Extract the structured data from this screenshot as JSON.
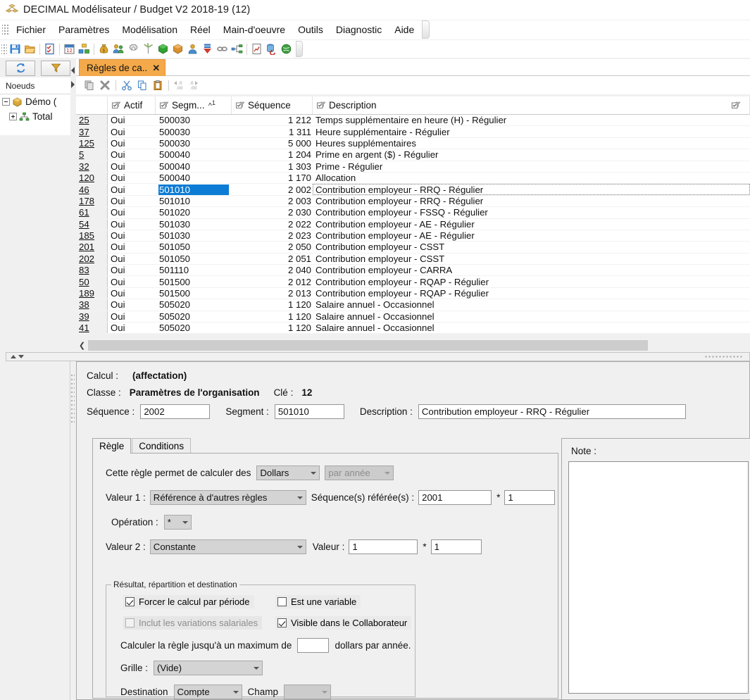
{
  "window": {
    "title": "DECIMAL Modélisateur / Budget V2 2018-19 (12)",
    "icon": "app-cubes-icon"
  },
  "menubar": {
    "items": [
      "Fichier",
      "Paramètres",
      "Modélisation",
      "Réel",
      "Main-d'oeuvre",
      "Outils",
      "Diagnostic",
      "Aide"
    ]
  },
  "toolbar": {
    "buttons": [
      {
        "name": "save-icon",
        "glyph": "save"
      },
      {
        "name": "open-folder-icon",
        "glyph": "folder"
      },
      {
        "name": "checklist-icon",
        "glyph": "checklist"
      },
      {
        "name": "calendar-icon",
        "glyph": "calendar"
      },
      {
        "name": "organization-icon",
        "glyph": "org"
      },
      {
        "name": "money-bag-icon",
        "glyph": "money"
      },
      {
        "name": "employees-icon",
        "glyph": "people"
      },
      {
        "name": "settings-gear-icon",
        "glyph": "gear"
      },
      {
        "name": "windmill-icon",
        "glyph": "windmill"
      },
      {
        "name": "green-cube-icon",
        "glyph": "greencube"
      },
      {
        "name": "orange-box-icon",
        "glyph": "orangebox"
      },
      {
        "name": "user-icon",
        "glyph": "user"
      },
      {
        "name": "import-down-arrows-icon",
        "glyph": "downarrows"
      },
      {
        "name": "link-chain-icon",
        "glyph": "chain"
      },
      {
        "name": "network-node-icon",
        "glyph": "network"
      },
      {
        "name": "report-chart-icon",
        "glyph": "report"
      },
      {
        "name": "database-refresh-icon",
        "glyph": "dbrefresh"
      },
      {
        "name": "refresh-globe-icon",
        "glyph": "globe"
      }
    ]
  },
  "secondary_toolbar": {
    "buttons": [
      {
        "name": "refresh-button",
        "icon": "refresh-icon"
      },
      {
        "name": "filter-button",
        "icon": "funnel-icon"
      }
    ]
  },
  "nav": {
    "header": "Noeuds",
    "tree": [
      {
        "label": "Démo (",
        "icon": "gold-cube-icon",
        "expander": "minus"
      },
      {
        "label": "Total",
        "icon": "hierarchy-icon",
        "expander": "plus"
      }
    ]
  },
  "doc_tab": {
    "label": "Règles de ca..",
    "close": "✕"
  },
  "grid_toolbar": {
    "buttons": [
      {
        "name": "duplicate-icon"
      },
      {
        "name": "delete-x-icon"
      },
      {
        "name": "cut-scissors-icon"
      },
      {
        "name": "copy-icon"
      },
      {
        "name": "paste-clipboard-icon"
      },
      {
        "name": "decrease-decimal-icon"
      },
      {
        "name": "increase-decimal-icon"
      }
    ]
  },
  "grid": {
    "columns": [
      {
        "key": "rownum",
        "label": ""
      },
      {
        "key": "actif",
        "label": "Actif"
      },
      {
        "key": "segment",
        "label": "Segm...",
        "sort": "^",
        "sort_order": "1"
      },
      {
        "key": "sequence",
        "label": "Séquence"
      },
      {
        "key": "description",
        "label": "Description"
      }
    ],
    "rows": [
      {
        "rownum": "25",
        "actif": "Oui",
        "segment": "500030",
        "sequence": "1 212",
        "description": "Temps supplémentaire en heure (H) - Régulier",
        "selected": false
      },
      {
        "rownum": "37",
        "actif": "Oui",
        "segment": "500030",
        "sequence": "1 311",
        "description": "Heure supplémentaire - Régulier",
        "selected": false
      },
      {
        "rownum": "125",
        "actif": "Oui",
        "segment": "500030",
        "sequence": "5 000",
        "description": "Heures supplémentaires",
        "selected": false
      },
      {
        "rownum": "5",
        "actif": "Oui",
        "segment": "500040",
        "sequence": "1 204",
        "description": "Prime en argent ($) - Régulier",
        "selected": false
      },
      {
        "rownum": "32",
        "actif": "Oui",
        "segment": "500040",
        "sequence": "1 303",
        "description": "Prime - Régulier",
        "selected": false
      },
      {
        "rownum": "120",
        "actif": "Oui",
        "segment": "500040",
        "sequence": "1 170",
        "description": "Allocation",
        "selected": false
      },
      {
        "rownum": "46",
        "actif": "Oui",
        "segment": "501010",
        "sequence": "2 002",
        "description": "Contribution employeur - RRQ - Régulier",
        "selected": true
      },
      {
        "rownum": "178",
        "actif": "Oui",
        "segment": "501010",
        "sequence": "2 003",
        "description": "Contribution employeur - RRQ - Régulier",
        "selected": false
      },
      {
        "rownum": "61",
        "actif": "Oui",
        "segment": "501020",
        "sequence": "2 030",
        "description": "Contribution employeur - FSSQ - Régulier",
        "selected": false
      },
      {
        "rownum": "54",
        "actif": "Oui",
        "segment": "501030",
        "sequence": "2 022",
        "description": "Contribution employeur - AE - Régulier",
        "selected": false
      },
      {
        "rownum": "185",
        "actif": "Oui",
        "segment": "501030",
        "sequence": "2 023",
        "description": "Contribution employeur - AE - Régulier",
        "selected": false
      },
      {
        "rownum": "201",
        "actif": "Oui",
        "segment": "501050",
        "sequence": "2 050",
        "description": "Contribution employeur - CSST",
        "selected": false
      },
      {
        "rownum": "202",
        "actif": "Oui",
        "segment": "501050",
        "sequence": "2 051",
        "description": "Contribution employeur - CSST",
        "selected": false
      },
      {
        "rownum": "83",
        "actif": "Oui",
        "segment": "501110",
        "sequence": "2 040",
        "description": "Contribution employeur - CARRA",
        "selected": false
      },
      {
        "rownum": "50",
        "actif": "Oui",
        "segment": "501500",
        "sequence": "2 012",
        "description": "Contribution employeur - RQAP - Régulier",
        "selected": false
      },
      {
        "rownum": "189",
        "actif": "Oui",
        "segment": "501500",
        "sequence": "2 013",
        "description": "Contribution employeur - RQAP - Régulier",
        "selected": false
      },
      {
        "rownum": "38",
        "actif": "Oui",
        "segment": "505020",
        "sequence": "1 120",
        "description": "Salaire annuel - Occasionnel",
        "selected": false
      },
      {
        "rownum": "39",
        "actif": "Oui",
        "segment": "505020",
        "sequence": "1 120",
        "description": "Salaire annuel - Occasionnel",
        "selected": false
      },
      {
        "rownum": "41",
        "actif": "Oui",
        "segment": "505020",
        "sequence": "1 120",
        "description": "Salaire annuel - Occasionnel",
        "selected": false
      }
    ]
  },
  "detail": {
    "calcul_label": "Calcul :",
    "calcul_value": "(affectation)",
    "classe_label": "Classe :",
    "classe_value": "Paramètres de l'organisation",
    "cle_label": "Clé :",
    "cle_value": "12",
    "sequence_label": "Séquence :",
    "sequence_value": "2002",
    "segment_label": "Segment :",
    "segment_value": "501010",
    "description_label": "Description :",
    "description_value": "Contribution employeur - RRQ - Régulier",
    "tabs": [
      {
        "label": "Règle",
        "active": true
      },
      {
        "label": "Conditions",
        "active": false
      }
    ],
    "rule": {
      "calc_prefix": "Cette règle permet de calculer des",
      "unit_combo": "Dollars",
      "period_combo": "par année",
      "valeur1_label": "Valeur 1 :",
      "valeur1_combo": "Référence à d'autres règles",
      "seq_ref_label": "Séquence(s) référée(s) :",
      "seq_ref_value": "2001",
      "seq_mult_sign": "*",
      "seq_mult_value": "1",
      "operation_label": "Opération :",
      "operation_combo": "*",
      "valeur2_label": "Valeur 2 :",
      "valeur2_combo": "Constante",
      "valeur_label": "Valeur :",
      "valeur_value": "1",
      "valeur_mult_sign": "*",
      "valeur_mult_value": "1"
    },
    "result_box": {
      "legend": "Résultat, répartition et destination",
      "checkboxes": [
        {
          "label": "Forcer le calcul par période",
          "checked": true,
          "disabled": false
        },
        {
          "label": "Est une variable",
          "checked": false,
          "disabled": false
        },
        {
          "label": "Inclut les variations salariales",
          "checked": false,
          "disabled": true
        },
        {
          "label": "Visible dans le Collaborateur",
          "checked": true,
          "disabled": false
        }
      ],
      "max_prefix": "Calculer la règle jusqu'à un maximum de",
      "max_value": "",
      "max_suffix": "dollars par année.",
      "grille_label": "Grille :",
      "grille_combo": "(Vide)",
      "destination_label": "Destination",
      "destination_combo": "Compte",
      "champ_label": "Champ",
      "champ_combo": ""
    },
    "note_label": "Note :",
    "note_value": ""
  },
  "colors": {
    "tab_accent": "#f4a94a",
    "selection_blue": "#0c7cd5",
    "panel_bg": "#f0f0f0",
    "grid_bg": "#ffffff"
  }
}
